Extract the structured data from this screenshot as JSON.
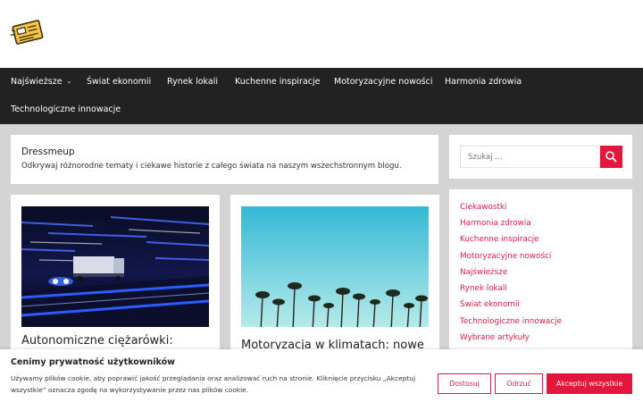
{
  "nav": {
    "items": [
      {
        "label": "Najświeższe",
        "has_dropdown": true
      },
      {
        "label": "Świat ekonomii"
      },
      {
        "label": "Rynek lokali"
      },
      {
        "label": "Kuchenne inspiracje"
      },
      {
        "label": "Motoryzacyjne nowości"
      },
      {
        "label": "Harmonia zdrowia"
      },
      {
        "label": "Technologiczne innowacje"
      }
    ],
    "dropdown_icon": "chevron-down-icon"
  },
  "intro": {
    "title": "Dressmeup",
    "description": "Odkrywaj różnorodne tematy i ciekawe historie z całego świata na naszym wszechstronnym blogu."
  },
  "posts": [
    {
      "title": "Autonomiczne ciężarówki:",
      "image": "truck-night-highway"
    },
    {
      "title": "Motoryzacja w klimatach: nowe",
      "image": "palm-trees-sky"
    }
  ],
  "search": {
    "placeholder": "Szukaj …",
    "button_icon": "search-icon"
  },
  "categories": [
    "Ciekawostki",
    "Harmonia zdrowia",
    "Kuchenne inspiracje",
    "Motoryzacyjne nowości",
    "Najświeższe",
    "Rynek lokali",
    "Świat ekonomii",
    "Technologiczne innowacje",
    "Wybrane artykuły"
  ],
  "cookie": {
    "title": "Cenimy prywatność użytkowników",
    "text": "Używamy plików cookie, aby poprawić jakość przeglądania oraz analizować ruch na stronie. Kliknięcie przycisku „Akceptuj wszystkie” oznacza zgodę na wykorzystywanie przez nas plików cookie.",
    "customize_label": "Dostosuj",
    "reject_label": "Odrzuć",
    "accept_label": "Akceptuj wszystkie"
  },
  "colors": {
    "accent": "#e2173b",
    "link": "#d81b44",
    "nav_bg": "#222222",
    "page_bg": "#d4d4d4"
  }
}
